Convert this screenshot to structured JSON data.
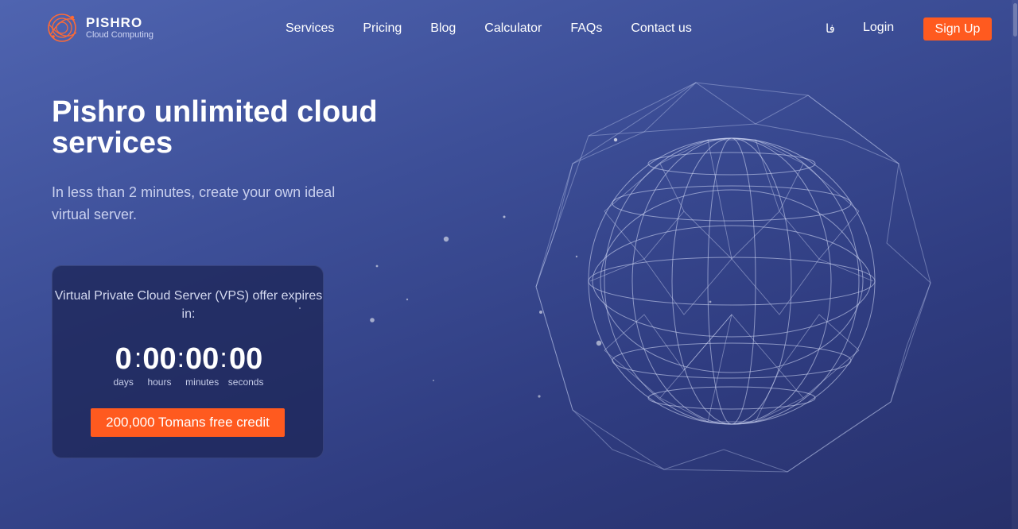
{
  "brand": {
    "name": "PISHRO",
    "tagline": "Cloud Computing",
    "accent_color": "#ff5a1f"
  },
  "nav": {
    "items": [
      {
        "label": "Services"
      },
      {
        "label": "Pricing"
      },
      {
        "label": "Blog"
      },
      {
        "label": "Calculator"
      },
      {
        "label": "FAQs"
      },
      {
        "label": "Contact us"
      }
    ],
    "language_label": "فا",
    "login_label": "Login",
    "signup_label": "Sign Up"
  },
  "hero": {
    "title": "Pishro unlimited cloud services",
    "subtitle": "In less than 2 minutes, create your own ideal virtual server."
  },
  "offer": {
    "title": "Virtual Private Cloud Server (VPS) offer expires in:",
    "countdown": {
      "days": "0",
      "hours": "00",
      "minutes": "00",
      "seconds": "00",
      "days_label": "days",
      "hours_label": "hours",
      "minutes_label": "minutes",
      "seconds_label": "seconds"
    },
    "cta_label": "200,000 Tomans free credit"
  },
  "icons": {
    "logo": "orbit-logo-icon",
    "decoration": "wireframe-globe"
  }
}
